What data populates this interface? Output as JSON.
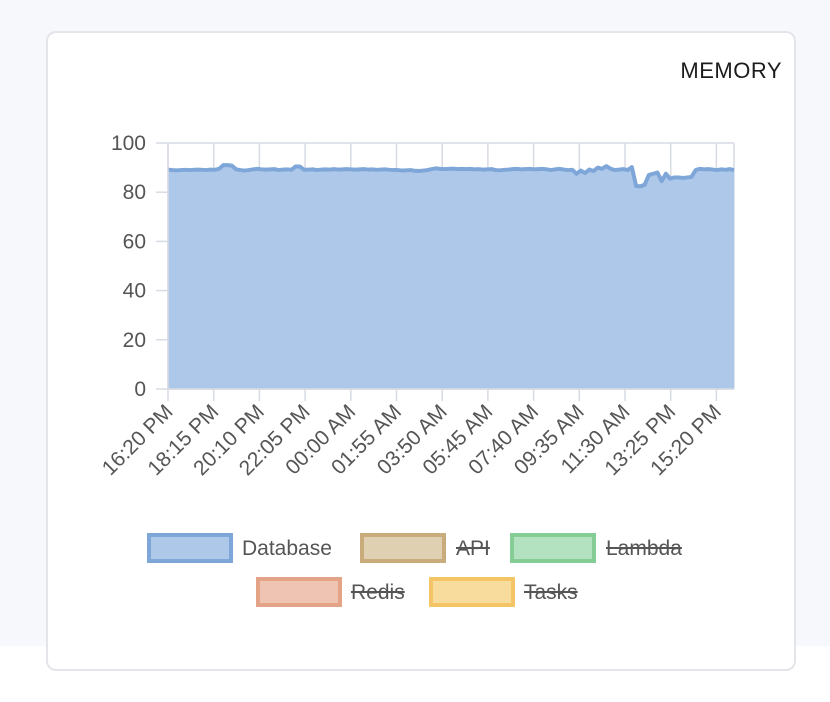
{
  "card": {
    "title": "MEMORY"
  },
  "colors": {
    "database_fill": "#adc8e8",
    "database_line": "#7fa6d9",
    "api_fill": "#dfd0b2",
    "api_line": "#c8ac7c",
    "lambda_fill": "#b2e2bf",
    "lambda_line": "#86cc97",
    "redis_fill": "#efc4b3",
    "redis_line": "#e4a286",
    "tasks_fill": "#f8dc9e",
    "tasks_line": "#f3c565",
    "grid": "#d7dbe3",
    "legend_strike": "#555555"
  },
  "chart_data": {
    "type": "area",
    "title": "MEMORY",
    "xlabel": "",
    "ylabel": "",
    "ylim": [
      0,
      100
    ],
    "yticks": [
      "0",
      "20",
      "40",
      "60",
      "80",
      "100"
    ],
    "xticks": [
      "16:20 PM",
      "18:15 PM",
      "20:10 PM",
      "22:05 PM",
      "00:00 AM",
      "01:55 AM",
      "03:50 AM",
      "05:45 AM",
      "07:40 AM",
      "09:35 AM",
      "11:30 AM",
      "13:25 PM",
      "15:20 PM"
    ],
    "grid": true,
    "legend_position": "bottom",
    "legend": [
      {
        "name": "Database",
        "hidden": false,
        "color_key": "database"
      },
      {
        "name": "API",
        "hidden": true,
        "color_key": "api"
      },
      {
        "name": "Lambda",
        "hidden": true,
        "color_key": "lambda"
      },
      {
        "name": "Redis",
        "hidden": true,
        "color_key": "redis"
      },
      {
        "name": "Tasks",
        "hidden": true,
        "color_key": "tasks"
      }
    ],
    "series": [
      {
        "name": "Database",
        "values": [
          89.2,
          89.0,
          88.9,
          89.0,
          89.1,
          89.0,
          89.1,
          89.2,
          89.1,
          89.0,
          89.2,
          89.1,
          89.5,
          91.0,
          91.0,
          90.8,
          89.3,
          89.0,
          88.8,
          89.0,
          89.3,
          89.5,
          89.3,
          89.2,
          89.3,
          89.4,
          89.0,
          89.2,
          89.3,
          89.1,
          90.5,
          90.4,
          89.1,
          89.2,
          89.3,
          89.0,
          89.2,
          89.3,
          89.2,
          89.4,
          89.2,
          89.3,
          89.4,
          89.3,
          89.2,
          89.3,
          89.4,
          89.2,
          89.3,
          89.1,
          89.2,
          89.3,
          89.1,
          89.0,
          89.0,
          88.8,
          88.9,
          89.0,
          88.7,
          88.6,
          88.8,
          89.0,
          89.4,
          89.7,
          89.5,
          89.4,
          89.5,
          89.6,
          89.4,
          89.5,
          89.4,
          89.5,
          89.3,
          89.4,
          89.2,
          89.3,
          89.4,
          89.0,
          88.9,
          89.1,
          89.2,
          89.4,
          89.5,
          89.3,
          89.4,
          89.5,
          89.3,
          89.4,
          89.5,
          89.3,
          89.0,
          89.3,
          89.5,
          89.2,
          89.0,
          89.1,
          87.5,
          88.8,
          87.8,
          89.2,
          88.6,
          90.0,
          89.5,
          90.6,
          89.5,
          89.0,
          89.2,
          89.4,
          89.0,
          90.2,
          82.5,
          82.4,
          83.0,
          87.0,
          87.5,
          88.0,
          84.5,
          87.5,
          85.5,
          86.0,
          86.0,
          85.8,
          86.0,
          86.2,
          89.0,
          89.5,
          89.3,
          89.4,
          89.2,
          89.0,
          89.3,
          89.1,
          89.4,
          89.0
        ]
      }
    ]
  }
}
